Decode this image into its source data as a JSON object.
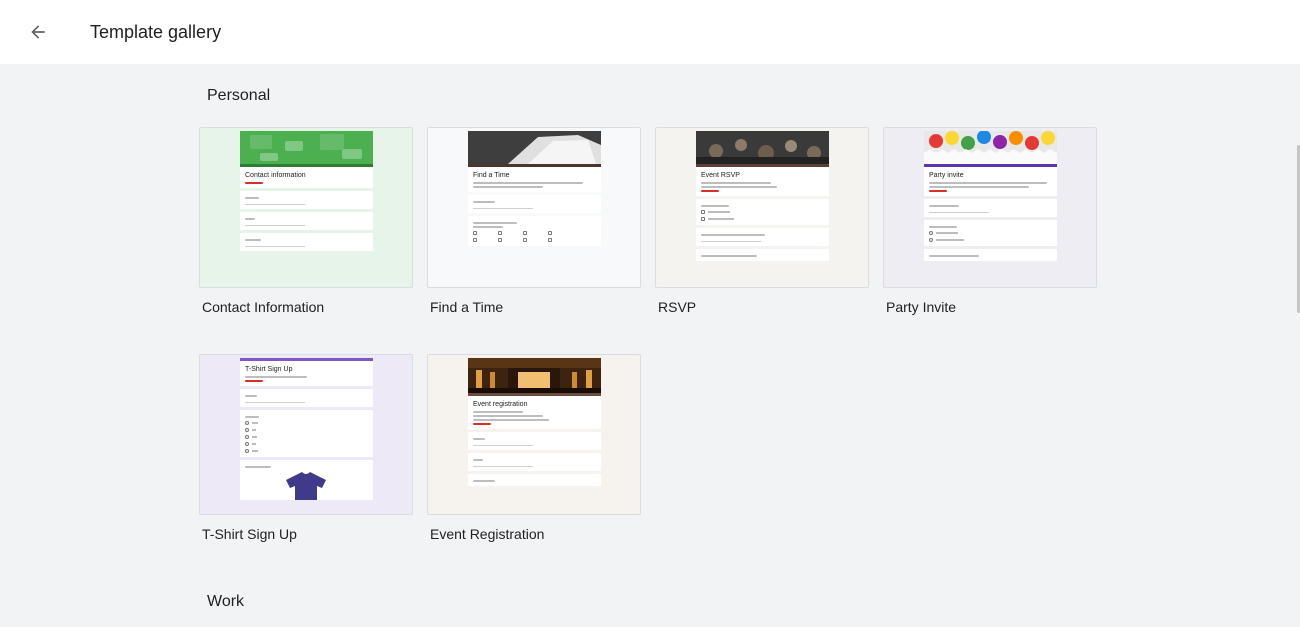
{
  "header": {
    "title": "Template gallery",
    "back_icon": "arrow-left-icon"
  },
  "sections": [
    {
      "title": "Personal"
    },
    {
      "title": "Work"
    }
  ],
  "templates": [
    {
      "label": "Contact Information",
      "preview_title": "Contact information",
      "bg": "#e6f4ea",
      "accent": "#34a853",
      "header_color": "#4caf50"
    },
    {
      "label": "Find a Time",
      "preview_title": "Find a Time",
      "bg": "#f8f9fa",
      "accent": "#5d4037",
      "header_color": "#6d6d6d"
    },
    {
      "label": "RSVP",
      "preview_title": "Event RSVP",
      "bg": "#f5f3f0",
      "accent": "#5d4037",
      "header_color": "#4a4a4a"
    },
    {
      "label": "Party Invite",
      "preview_title": "Party invite",
      "bg": "#efedf4",
      "accent": "#5e35b1",
      "header_color": "#e0e0e0"
    },
    {
      "label": "T-Shirt Sign Up",
      "preview_title": "T-Shirt Sign Up",
      "bg": "#ede9f6",
      "accent": "#7e57c2",
      "header_color": "#7e57c2"
    },
    {
      "label": "Event Registration",
      "preview_title": "Event registration",
      "bg": "#f6f3ef",
      "accent": "#6d4c41",
      "header_color": "#5d3a1a"
    }
  ]
}
